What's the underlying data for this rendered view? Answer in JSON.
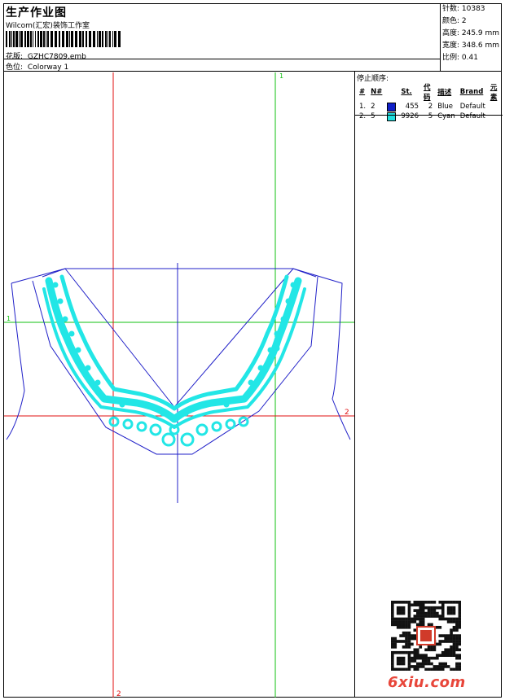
{
  "header": {
    "title": "生产作业图",
    "company": "Wilcom(汇宏)装饰工作室",
    "design_label": "花版:",
    "design_value": "GZHC7809.emb",
    "colorway_label": "色位:",
    "colorway_value": "Colorway 1"
  },
  "stats": {
    "stitches": "针数: 10383",
    "colors": "颜色: 2",
    "height": "高度: 245.9 mm",
    "width": "宽度: 348.6 mm",
    "scale": "比例: 0.41"
  },
  "stop_sequence": {
    "title": "停止顺序:",
    "columns": [
      "#",
      "N#",
      "St.",
      "代码",
      "描述",
      "Brand",
      "元素"
    ],
    "rows": [
      {
        "idx": "1.",
        "n": "2",
        "color": "#1020c8",
        "st": "455",
        "code": "2",
        "desc": "Blue",
        "brand": "Default"
      },
      {
        "idx": "2.",
        "n": "5",
        "color": "#22e0e0",
        "st": "9926",
        "code": "5",
        "desc": "Cyan",
        "brand": "Default"
      }
    ]
  },
  "guides": {
    "green_vertical_label": "1",
    "green_horizontal_label": "1",
    "red_horizontal_label": "2",
    "red_vertical_label": "2"
  },
  "colors": {
    "cyan_stitch": "#22e6e6",
    "blue_outline": "#2020c8",
    "red_guide": "#e01010",
    "green_guide": "#10c010"
  },
  "watermark": "6xiu.com"
}
